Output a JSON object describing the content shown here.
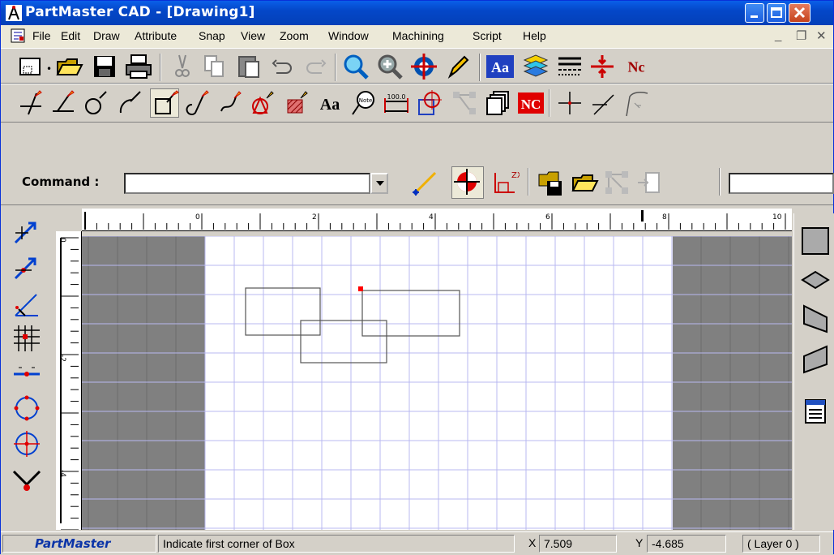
{
  "window": {
    "title": "PartMaster CAD - [Drawing1]"
  },
  "menu": {
    "items": [
      "File",
      "Edit",
      "Draw",
      "Attribute",
      "Snap",
      "View",
      "Zoom",
      "Window",
      "Machining",
      "Script",
      "Help"
    ],
    "mdi_min": "_",
    "mdi_restore": "❐",
    "mdi_close": "✕"
  },
  "toolbar_text": {
    "font_button": "Aa",
    "nc_button": "Nc",
    "text_tool": "Aa",
    "note_tool": "Note",
    "dim_tool": "100.0",
    "nc_badge": "NC",
    "zx_label": "ZX"
  },
  "command": {
    "label": "Command :",
    "value": ""
  },
  "ruler": {
    "h_labels": [
      "0",
      "2",
      "4",
      "6",
      "8",
      "10"
    ],
    "v_labels": [
      "0",
      "-2",
      "-4"
    ]
  },
  "status": {
    "brand": "PartMaster",
    "message": "Indicate first corner of Box",
    "x_label": "X",
    "x_value": "7.509",
    "y_label": "Y",
    "y_value": "-4.685",
    "layer": "( Layer 0 )"
  },
  "colors": {
    "title_blue": "#0447c8",
    "grid_line": "#b9b9f0",
    "margin_gray": "#808080",
    "accent_red": "#ff0000"
  }
}
